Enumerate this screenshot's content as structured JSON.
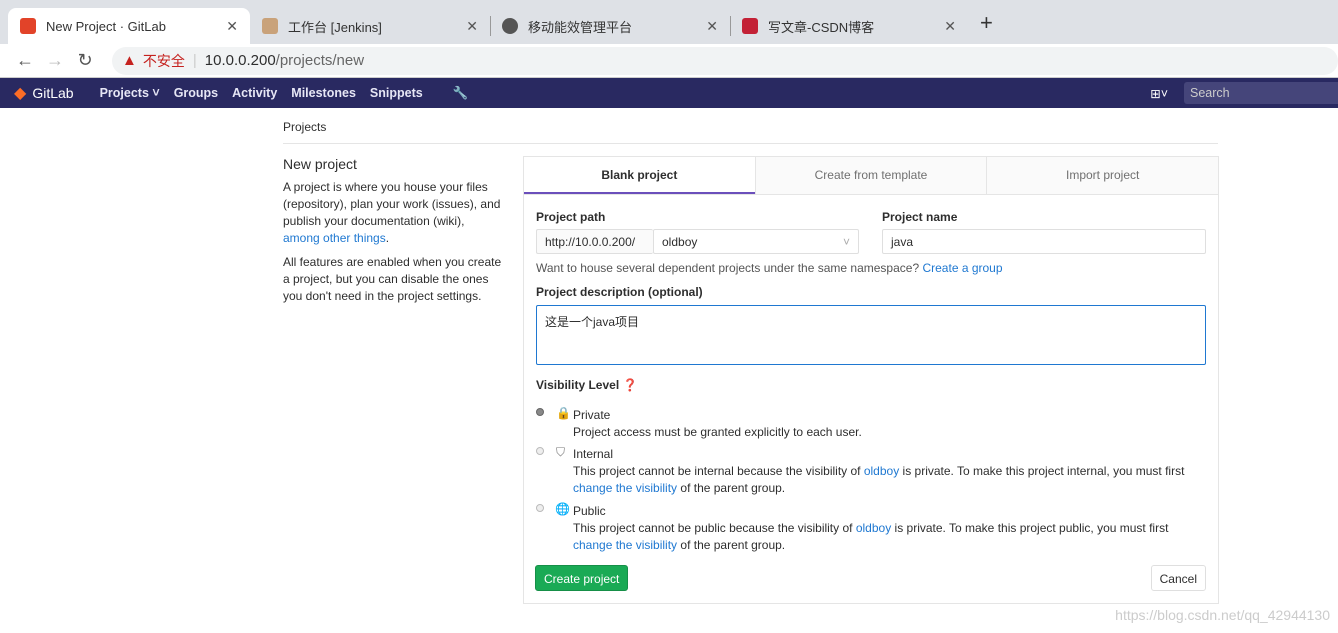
{
  "browser": {
    "tabs": [
      {
        "title": "New Project · GitLab"
      },
      {
        "title": "工作台 [Jenkins]"
      },
      {
        "title": "移动能效管理平台"
      },
      {
        "title": "写文章-CSDN博客"
      }
    ],
    "security": "不安全",
    "url_host": "10.0.0.200",
    "url_path": "/projects/new"
  },
  "nav": {
    "brand": "GitLab",
    "items": [
      "Projects",
      "Groups",
      "Activity",
      "Milestones",
      "Snippets"
    ],
    "search_placeholder": "Search"
  },
  "breadcrumb": "Projects",
  "intro": {
    "title": "New project",
    "p1": "A project is where you house your files (repository), plan your work (issues), and publish your documentation (wiki), ",
    "p1_link": "among other things",
    "p1_end": ".",
    "p2": "All features are enabled when you create a project, but you can disable the ones you don't need in the project settings."
  },
  "tabs": [
    "Blank project",
    "Create from template",
    "Import project"
  ],
  "form": {
    "path_label": "Project path",
    "path_prefix": "http://10.0.0.200/",
    "namespace": "oldboy",
    "name_label": "Project name",
    "name_value": "java",
    "hint": "Want to house several dependent projects under the same namespace? ",
    "hint_link": "Create a group",
    "desc_label": "Project description (optional)",
    "desc_value": "这是一个java项目",
    "vis_label": "Visibility Level",
    "visibility": [
      {
        "title": "Private",
        "desc": "Project access must be granted explicitly to each user.",
        "selected": true
      },
      {
        "title": "Internal",
        "desc_a": "This project cannot be internal because the visibility of ",
        "group": "oldboy",
        "desc_b": " is private. To make this project internal, you must first",
        "link": "change the visibility",
        "desc_c": " of the parent group."
      },
      {
        "title": "Public",
        "desc_a": "This project cannot be public because the visibility of ",
        "group": "oldboy",
        "desc_b": " is private. To make this project public, you must first",
        "link": "change the visibility",
        "desc_c": " of the parent group."
      }
    ],
    "create": "Create project",
    "cancel": "Cancel"
  },
  "watermark": "https://blog.csdn.net/qq_42944130"
}
